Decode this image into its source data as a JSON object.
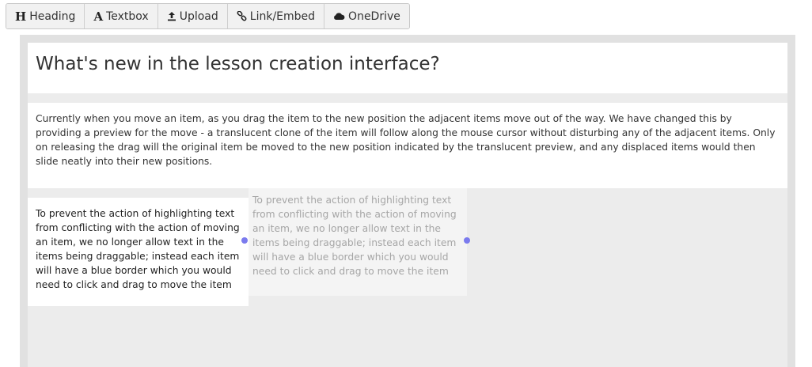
{
  "toolbar": {
    "buttons": [
      {
        "label": "Heading",
        "icon": "heading-icon"
      },
      {
        "label": "Textbox",
        "icon": "textbox-icon"
      },
      {
        "label": "Upload",
        "icon": "upload-icon"
      },
      {
        "label": "Link/Embed",
        "icon": "link-icon"
      },
      {
        "label": "OneDrive",
        "icon": "cloud-icon"
      }
    ]
  },
  "lesson": {
    "heading": "What's new in the lesson creation interface?",
    "paragraph": "Currently when you move an item, as you drag the item to the new position the adjacent items move out of the way. We have changed this by providing a preview for the move - a translucent clone of the item will follow along the mouse cursor without disturbing any of the adjacent items. Only on releasing the drag will the original item be moved to the new position indicated by the translucent preview, and any displaced items would then slide neatly into their new positions.",
    "item_text": "To prevent the action of highlighting text from conflicting with the action of moving an item, we no longer allow text in the items being draggable; instead each item will have a blue border which you would need to click and drag to move the item",
    "ghost_text": "To prevent the action of highlighting text from conflicting with the action of moving an item, we no longer allow text in the items being draggable; instead each item will have a blue border which you would need to click and drag to move the item"
  },
  "colors": {
    "handle": "#7b7bee",
    "canvas_bg": "#ececec"
  }
}
